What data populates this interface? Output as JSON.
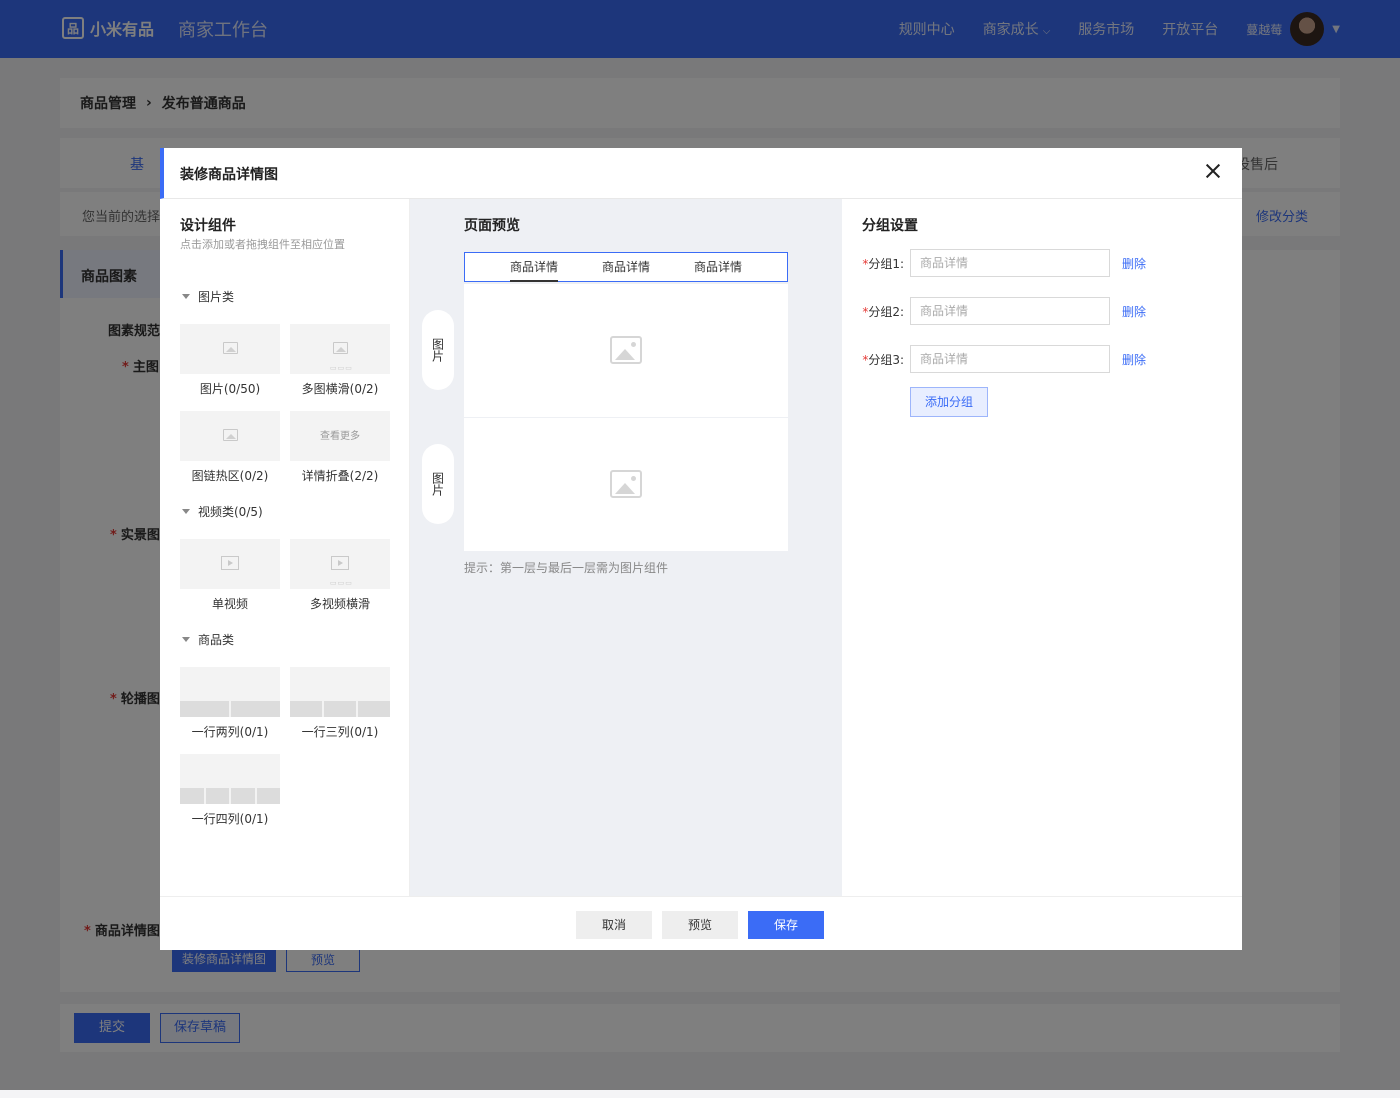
{
  "header": {
    "logo_mark": "品",
    "logo_text": "小米有品",
    "app_title": "商家工作台",
    "nav": [
      "规则中心",
      "商家成长",
      "服务市场",
      "开放平台"
    ],
    "user_name": "蔓越莓"
  },
  "background": {
    "breadcrumb": [
      "商品管理",
      "发布普通商品"
    ],
    "tab_left": "基",
    "tab_right": "设售后",
    "category_text": "您当前的选择",
    "category_edit": "修改分类",
    "side_item": "商品图素",
    "labels": {
      "spec": "图素规范",
      "main": "主图",
      "real": "实景图",
      "carousel": "轮播图",
      "detail": "商品详情图"
    },
    "detail_buttons": [
      "装修商品详情图",
      "预览"
    ],
    "submit": "提交",
    "save_draft": "保存草稿"
  },
  "modal": {
    "title": "装修商品详情图",
    "left": {
      "title": "设计组件",
      "subtitle": "点击添加或者拖拽组件至相应位置",
      "groups": [
        {
          "name": "图片类",
          "items": [
            "图片(0/50)",
            "多图横滑(0/2)",
            "图链热区(0/2)",
            "详情折叠(2/2)"
          ],
          "more_text": "查看更多"
        },
        {
          "name": "视频类(0/5)",
          "items": [
            "单视频",
            "多视频横滑"
          ]
        },
        {
          "name": "商品类",
          "items": [
            "一行两列(0/1)",
            "一行三列(0/1)",
            "一行四列(0/1)"
          ]
        }
      ]
    },
    "middle": {
      "title": "页面预览",
      "tabs": [
        "商品详情",
        "商品详情",
        "商品详情"
      ],
      "active_tab": 0,
      "pill_label": "图片",
      "hint": "提示：第一层与最后一层需为图片组件"
    },
    "right": {
      "title": "分组设置",
      "groups": [
        {
          "label": "分组1:",
          "placeholder": "商品详情",
          "delete": "删除"
        },
        {
          "label": "分组2:",
          "placeholder": "商品详情",
          "delete": "删除"
        },
        {
          "label": "分组3:",
          "placeholder": "商品详情",
          "delete": "删除"
        }
      ],
      "add_label": "添加分组"
    },
    "footer": {
      "cancel": "取消",
      "preview": "预览",
      "save": "保存"
    }
  },
  "colors": {
    "accent": "#3b6cf6",
    "required": "#e53935"
  }
}
